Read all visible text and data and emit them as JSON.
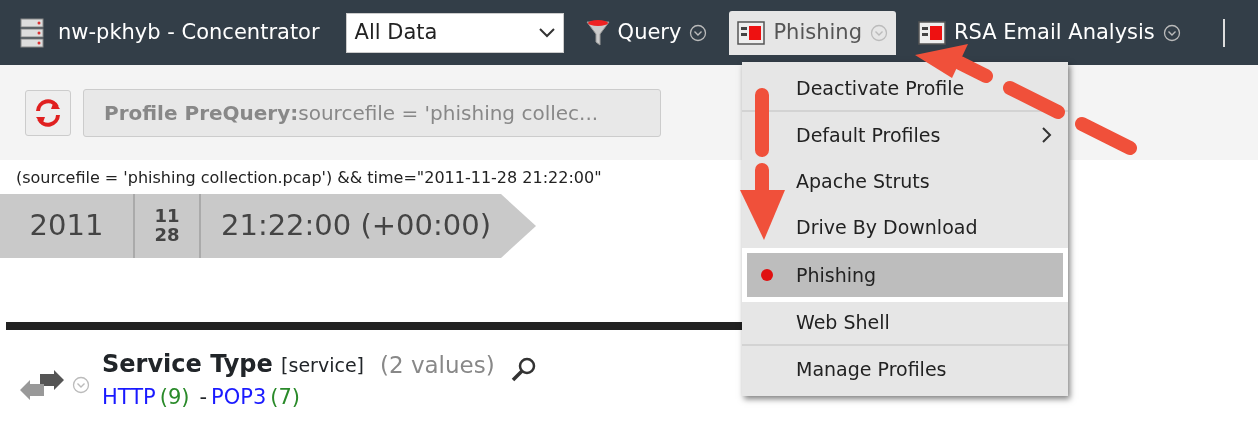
{
  "toolbar": {
    "title": "nw-pkhyb - Concentrator",
    "data_select": "All Data",
    "buttons": [
      {
        "kind": "query",
        "label": "Query",
        "selected": false
      },
      {
        "kind": "profile",
        "label": "Phishing",
        "selected": true
      },
      {
        "kind": "profile",
        "label": "RSA Email Analysis",
        "selected": false
      }
    ]
  },
  "prequery": {
    "label": "Profile PreQuery:",
    "value": "sourcefile = 'phishing collec..."
  },
  "query_text": "(sourcefile = 'phishing collection.pcap') && time=\"2011-11-28 21:22:00\"",
  "timeline": {
    "year": "2011",
    "month": "11",
    "day": "28",
    "time": "21:22:00 (+00:00)"
  },
  "meta": {
    "title": "Service Type",
    "key": "[service]",
    "count": "(2 values)",
    "separator": "-",
    "values": [
      {
        "name": "HTTP",
        "count": "(9)"
      },
      {
        "name": "POP3",
        "count": "(7)"
      }
    ]
  },
  "menu": [
    {
      "label": "Deactivate Profile",
      "selected": false,
      "submenu": false,
      "divider": true
    },
    {
      "label": "Default Profiles",
      "selected": false,
      "submenu": true,
      "divider": false
    },
    {
      "label": "Apache Struts",
      "selected": false,
      "submenu": false,
      "divider": false
    },
    {
      "label": "Drive By Download",
      "selected": false,
      "submenu": false,
      "divider": false
    },
    {
      "label": "Phishing",
      "selected": true,
      "submenu": false,
      "divider": false
    },
    {
      "label": "Web Shell",
      "selected": false,
      "submenu": false,
      "divider": true
    },
    {
      "label": "Manage Profiles",
      "selected": false,
      "submenu": false,
      "divider": false
    }
  ]
}
